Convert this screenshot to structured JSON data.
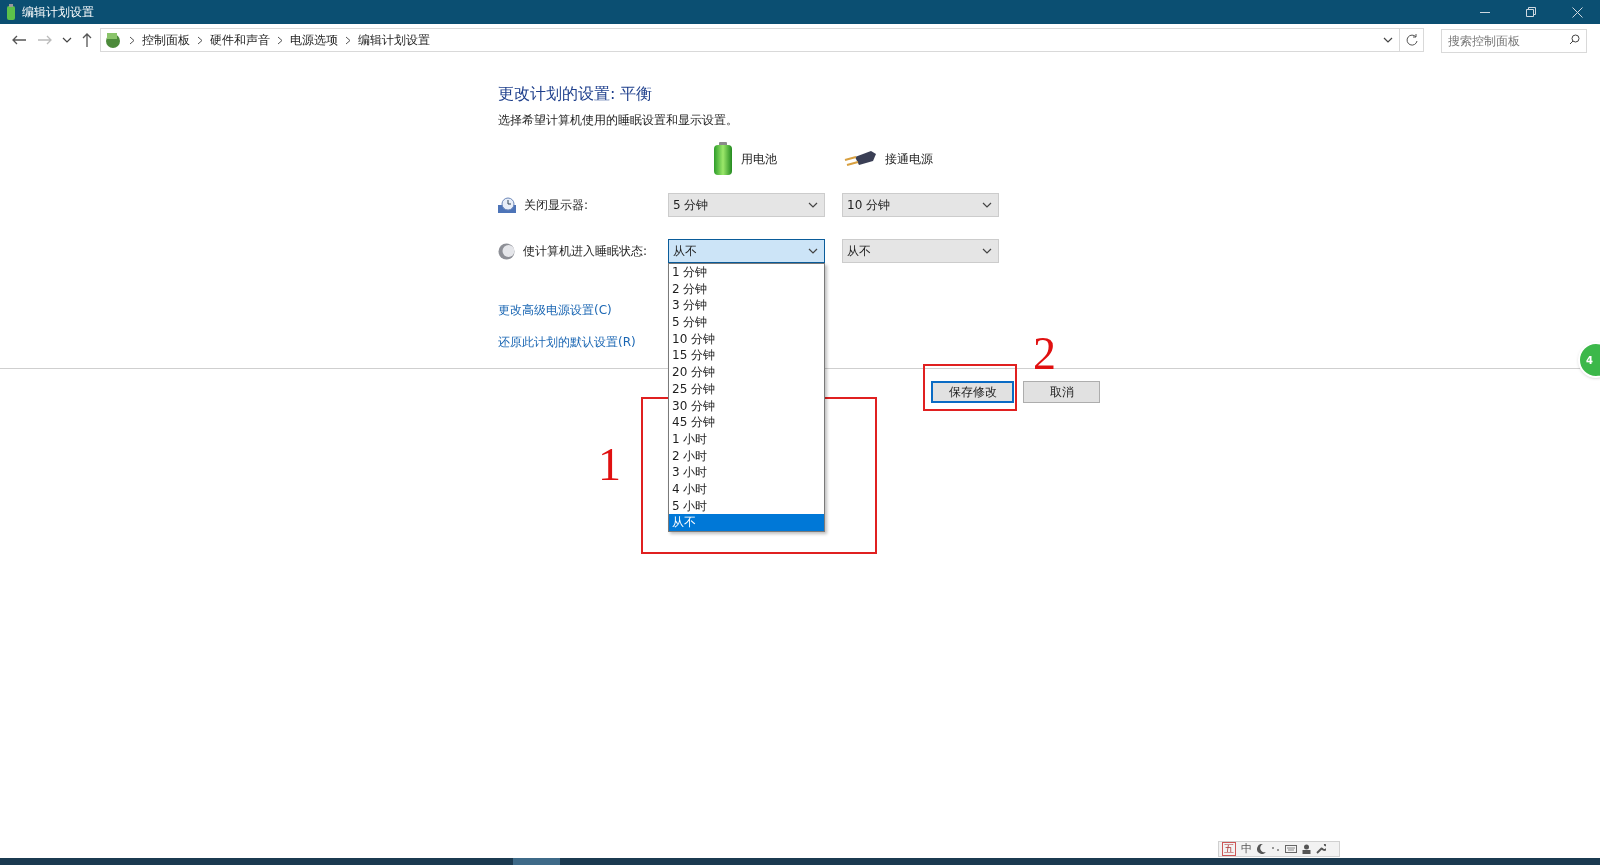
{
  "window": {
    "title": "编辑计划设置"
  },
  "address_bar": {
    "breadcrumbs": [
      "控制面板",
      "硬件和声音",
      "电源选项",
      "编辑计划设置"
    ]
  },
  "search": {
    "placeholder": "搜索控制面板"
  },
  "heading": "更改计划的设置: 平衡",
  "description": "选择希望计算机使用的睡眠设置和显示设置。",
  "columns": [
    {
      "label": "用电池",
      "kind": "battery"
    },
    {
      "label": "接通电源",
      "kind": "plug"
    }
  ],
  "settings": [
    {
      "label": "关闭显示器:",
      "kind": "display",
      "values": [
        {
          "value": "5 分钟",
          "open": false
        },
        {
          "value": "10 分钟",
          "open": false
        }
      ]
    },
    {
      "label": "使计算机进入睡眠状态:",
      "kind": "sleep",
      "values": [
        {
          "value": "从不",
          "open": true
        },
        {
          "value": "从不",
          "open": false
        }
      ]
    }
  ],
  "dropdown_options": [
    {
      "label": "1 分钟",
      "selected": false
    },
    {
      "label": "2 分钟",
      "selected": false
    },
    {
      "label": "3 分钟",
      "selected": false
    },
    {
      "label": "5 分钟",
      "selected": false
    },
    {
      "label": "10 分钟",
      "selected": false
    },
    {
      "label": "15 分钟",
      "selected": false
    },
    {
      "label": "20 分钟",
      "selected": false
    },
    {
      "label": "25 分钟",
      "selected": false
    },
    {
      "label": "30 分钟",
      "selected": false
    },
    {
      "label": "45 分钟",
      "selected": false
    },
    {
      "label": "1 小时",
      "selected": false
    },
    {
      "label": "2 小时",
      "selected": false
    },
    {
      "label": "3 小时",
      "selected": false
    },
    {
      "label": "4 小时",
      "selected": false
    },
    {
      "label": "5 小时",
      "selected": false
    },
    {
      "label": "从不",
      "selected": true
    }
  ],
  "links": [
    "更改高级电源设置(C)",
    "还原此计划的默认设置(R)"
  ],
  "buttons": [
    {
      "label": "保存修改",
      "kind": "default"
    },
    {
      "label": "取消",
      "kind": "normal"
    }
  ],
  "annotations": [
    {
      "label": "1"
    },
    {
      "label": "2"
    }
  ],
  "side_badge": {
    "label": "4"
  },
  "ime_toolbar": {
    "items": [
      "五",
      "中"
    ]
  }
}
